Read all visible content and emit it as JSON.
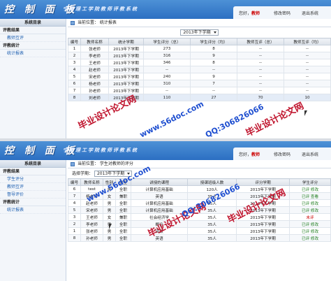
{
  "app": {
    "logo": "控 制 面 板",
    "subtitle": "宁夏理工学院教师评教系统",
    "user_label": "您好，",
    "user_name": "教师",
    "change_password": "修改密码",
    "logout": "退出系统"
  },
  "top": {
    "sidebar": {
      "title": "系统目录",
      "group1": "评教结果",
      "item1": "教师互评",
      "group2": "评教统计",
      "item2": "统计报表"
    },
    "breadcrumb": "当前位置：  统计报表",
    "semester_selected": "2013年下学期",
    "table": {
      "headers": [
        "编号",
        "教师名称",
        "统计学期",
        "学生评分（总）",
        "学生评分（均）",
        "教师互评（总）",
        "教师互评（均）"
      ],
      "rows": [
        [
          "1",
          "张老师",
          "2013年下学期",
          "273",
          "8",
          "--",
          "--"
        ],
        [
          "2",
          "李老师",
          "2013年下学期",
          "316",
          "9",
          "--",
          "--"
        ],
        [
          "3",
          "王老师",
          "2013年下学期",
          "346",
          "8",
          "--",
          "--"
        ],
        [
          "4",
          "赵老师",
          "2013年下学期",
          "--",
          "--",
          "--",
          "--"
        ],
        [
          "5",
          "宋老师",
          "2013年下学期",
          "240",
          "9",
          "--",
          "--"
        ],
        [
          "6",
          "杨老师",
          "2013年下学期",
          "310",
          "7",
          "--",
          "--"
        ],
        [
          "7",
          "孙老师",
          "2013年下学期",
          "--",
          "--",
          "--",
          "--"
        ],
        [
          "8",
          "刘老师",
          "2013年下学期",
          "110",
          "27",
          "70",
          "10"
        ]
      ]
    }
  },
  "bottom": {
    "sidebar": {
      "title": "系统目录",
      "group1": "评教结果",
      "item1": "学生评分",
      "item2": "教师互评",
      "item3": "督导评价",
      "group2": "评教统计",
      "item4": "统计报表"
    },
    "breadcrumb": "当前位置：  学生对教师的评分",
    "select_label": "选择学期：",
    "semester_selected": "2013年下学期",
    "table": {
      "headers": [
        "编号",
        "教师名称",
        "性别",
        "类型",
        "讲授的课程",
        "授课班级人数",
        "评分学期",
        "学生评分"
      ],
      "rows": [
        [
          "6",
          "test",
          "男",
          "全职",
          "计算机应用基础",
          "120人",
          "2013年下学期",
          "已评 修改"
        ],
        [
          "7",
          "杨老师",
          "女",
          "兼职",
          "英语",
          "35人",
          "2013年下学期",
          "已评 查看"
        ],
        [
          "4",
          "赵老师",
          "男",
          "全职",
          "计算机应用基础",
          "35人",
          "2013年下学期",
          "已评 修改"
        ],
        [
          "5",
          "宋老师",
          "男",
          "全职",
          "计算机应用基础",
          "35人",
          "2013年下学期",
          "已评 修改"
        ],
        [
          "3",
          "王老师",
          "女",
          "兼职",
          "社会经济学",
          "35人",
          "2013年下学期",
          "未评"
        ],
        [
          "2",
          "李老师",
          "男",
          "全职",
          "概论",
          "35人",
          "2013年下学期",
          "已评 修改"
        ],
        [
          "1",
          "张老师",
          "男",
          "全职",
          "高数",
          "35人",
          "2013年下学期",
          "已评 修改"
        ],
        [
          "8",
          "孙老师",
          "男",
          "全职",
          "英语",
          "35人",
          "2013年下学期",
          "已评 修改"
        ]
      ]
    }
  },
  "watermarks": {
    "text": "毕业设计论文网",
    "url": "www.56doc.com",
    "qq": "QQ:306826066"
  },
  "colors": {
    "header": "#2c6fc2",
    "link": "#1d5fb0",
    "watermark_red": "#c0152e",
    "watermark_blue": "#1f4fd0"
  }
}
